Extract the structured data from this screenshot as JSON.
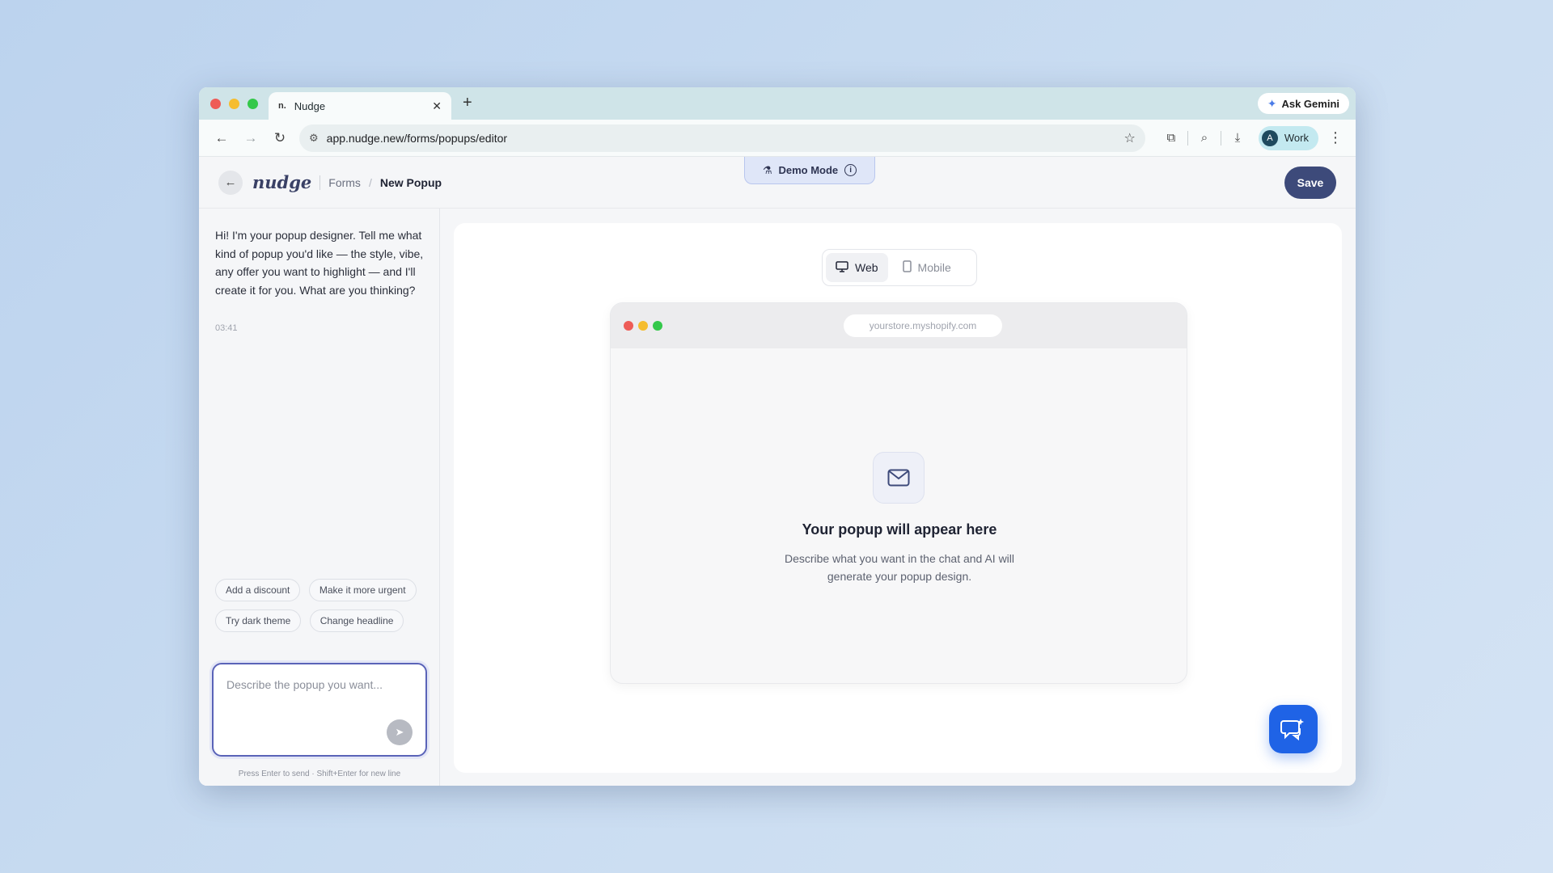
{
  "browser": {
    "tab_title": "Nudge",
    "tab_favicon": "n.",
    "ask_gemini": "Ask Gemini",
    "url": "app.nudge.new/forms/popups/editor",
    "profile_initial": "A",
    "profile_name": "Work"
  },
  "header": {
    "logo": "nudge",
    "breadcrumb_parent": "Forms",
    "breadcrumb_current": "New Popup",
    "demo_mode": "Demo Mode",
    "save_label": "Save"
  },
  "chat": {
    "message": "Hi! I'm your popup designer. Tell me what kind of popup you'd like — the style, vibe, any offer you want to highlight — and I'll create it for you. What are you thinking?",
    "time": "03:41",
    "suggestions": [
      "Add a discount",
      "Make it more urgent",
      "Try dark theme",
      "Change headline"
    ],
    "input_placeholder": "Describe the popup you want...",
    "hint": "Press Enter to send · Shift+Enter for new line"
  },
  "preview": {
    "device_web": "Web",
    "device_mobile": "Mobile",
    "active_device": "Web",
    "mock_url": "yourstore.myshopify.com",
    "empty_title": "Your popup will appear here",
    "empty_desc": "Describe what you want in the chat and AI will generate your popup design."
  },
  "colors": {
    "accent": "#3d4a7a",
    "fab": "#1f63e6",
    "input_focus": "#5a63b8"
  }
}
